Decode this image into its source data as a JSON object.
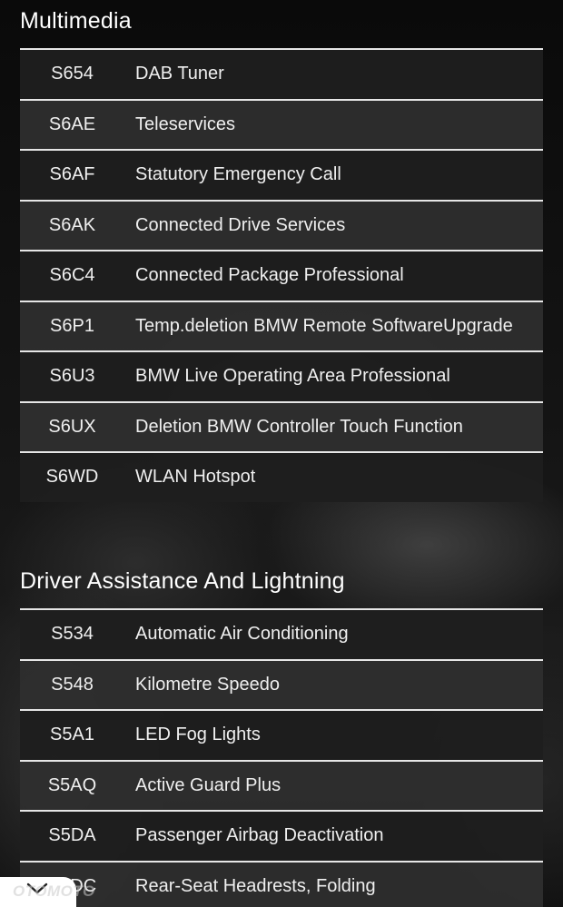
{
  "sections": [
    {
      "title": "Multimedia",
      "rows": [
        {
          "code": "S654",
          "desc": "DAB Tuner"
        },
        {
          "code": "S6AE",
          "desc": "Teleservices"
        },
        {
          "code": "S6AF",
          "desc": "Statutory Emergency Call"
        },
        {
          "code": "S6AK",
          "desc": "Connected Drive Services"
        },
        {
          "code": "S6C4",
          "desc": "Connected Package Professional"
        },
        {
          "code": "S6P1",
          "desc": "Temp.deletion BMW Remote SoftwareUpgrade"
        },
        {
          "code": "S6U3",
          "desc": "BMW Live Operating Area Professional"
        },
        {
          "code": "S6UX",
          "desc": "Deletion BMW Controller Touch Function"
        },
        {
          "code": "S6WD",
          "desc": "WLAN Hotspot"
        }
      ]
    },
    {
      "title": "Driver Assistance And Lightning",
      "rows": [
        {
          "code": "S534",
          "desc": "Automatic Air Conditioning"
        },
        {
          "code": "S548",
          "desc": "Kilometre Speedo"
        },
        {
          "code": "S5A1",
          "desc": "LED Fog Lights"
        },
        {
          "code": "S5AQ",
          "desc": "Active Guard Plus"
        },
        {
          "code": "S5DA",
          "desc": "Passenger Airbag Deactivation"
        },
        {
          "code": "S5DC",
          "desc": "Rear-Seat Headrests, Folding"
        }
      ]
    }
  ],
  "scroll_button": {
    "icon": "chevron-down-icon"
  },
  "watermark": "OTOMOTO"
}
